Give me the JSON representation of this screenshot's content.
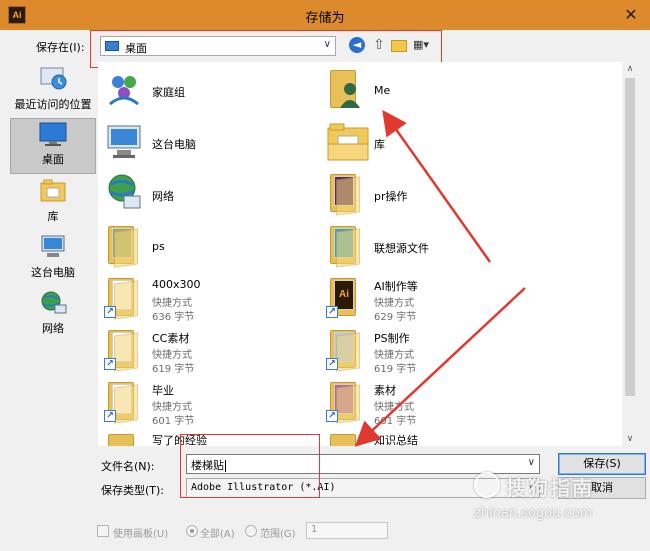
{
  "window": {
    "app_icon": "Ai",
    "title": "存储为",
    "close_glyph": "✕"
  },
  "savein": {
    "label": "保存在(I):",
    "value": "桌面",
    "icons": [
      "back-icon",
      "up-folder-icon",
      "new-folder-icon",
      "view-menu-icon"
    ]
  },
  "places": [
    {
      "label": "最近访问的位置",
      "icon": "recent-places-icon"
    },
    {
      "label": "桌面",
      "icon": "desktop-icon",
      "selected": true
    },
    {
      "label": "库",
      "icon": "libraries-icon"
    },
    {
      "label": "这台电脑",
      "icon": "this-pc-icon"
    },
    {
      "label": "网络",
      "icon": "network-icon"
    }
  ],
  "files": [
    {
      "name": "家庭组",
      "icon": "homegroup-icon"
    },
    {
      "name": "Me",
      "icon": "user-folder-icon"
    },
    {
      "name": "这台电脑",
      "icon": "this-pc-icon"
    },
    {
      "name": "库",
      "icon": "libraries-folder-icon"
    },
    {
      "name": "网络",
      "icon": "network-icon"
    },
    {
      "name": "pr操作",
      "icon": "folder-icon"
    },
    {
      "name": "ps",
      "icon": "folder-icon"
    },
    {
      "name": "联想源文件",
      "icon": "folder-icon"
    },
    {
      "name": "400x300",
      "type": "快捷方式",
      "size": "636 字节",
      "icon": "shortcut-folder-icon"
    },
    {
      "name": "AI制作等",
      "type": "快捷方式",
      "size": "629 字节",
      "icon": "shortcut-folder-icon"
    },
    {
      "name": "CC素材",
      "type": "快捷方式",
      "size": "619 字节",
      "icon": "shortcut-folder-icon"
    },
    {
      "name": "PS制作",
      "type": "快捷方式",
      "size": "619 字节",
      "icon": "shortcut-folder-icon"
    },
    {
      "name": "毕业",
      "type": "快捷方式",
      "size": "601 字节",
      "icon": "shortcut-folder-icon"
    },
    {
      "name": "素材",
      "type": "快捷方式",
      "size": "601 字节",
      "icon": "shortcut-folder-icon"
    },
    {
      "name": "写了的经验",
      "icon": "folder-icon"
    },
    {
      "name": "知识总结",
      "icon": "folder-icon"
    }
  ],
  "filename": {
    "label": "文件名(N):",
    "value": "楼梯贴"
  },
  "filetype": {
    "label": "保存类型(T):",
    "value": "Adobe Illustrator (*.AI)"
  },
  "buttons": {
    "save": "保存(S)",
    "cancel": "取消"
  },
  "bottom_options": {
    "use_artboards": "使用画板(U)",
    "all": "全部(A)",
    "range": "范围(G)",
    "range_value": "1"
  },
  "watermark": {
    "brand": "搜狗指南",
    "url": "zhinan.sogou.com"
  },
  "colors": {
    "titlebar": "#dc8a2b",
    "annotation_red": "#e0392f",
    "selection": "#c9c9c9"
  }
}
